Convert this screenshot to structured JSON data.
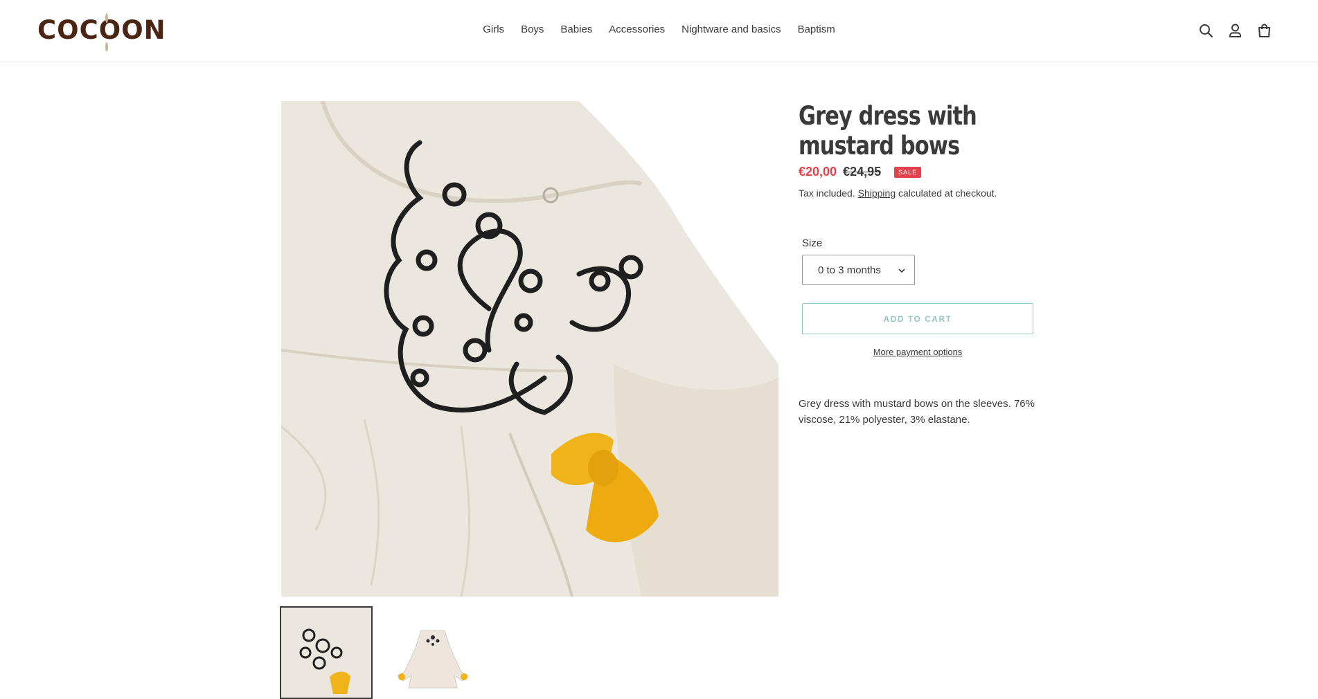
{
  "brand": {
    "logo_text": "COCOON"
  },
  "nav": {
    "items": [
      "Girls",
      "Boys",
      "Babies",
      "Accessories",
      "Nightware and basics",
      "Baptism"
    ]
  },
  "header_icons": [
    "search-icon",
    "account-icon",
    "cart-icon"
  ],
  "product": {
    "title": "Grey dress with mustard bows",
    "sale_price": "€20,00",
    "regular_price": "€24,95",
    "badge": "SALE",
    "tax_prefix": "Tax included.",
    "tax_link": "Shipping",
    "tax_suffix": "calculated at checkout.",
    "size_label": "Size",
    "size_value": "0 to 3 months",
    "add_to_cart": "ADD TO CART",
    "more_payment": "More payment options",
    "description": "Grey dress with mustard bows on the sleeves. 76% viscose, 21% polyester, 3% elastane."
  },
  "colors": {
    "sale": "#e4434b",
    "accent": "#94c7c6",
    "brand": "#4a2513",
    "text": "#3a3a3a"
  }
}
